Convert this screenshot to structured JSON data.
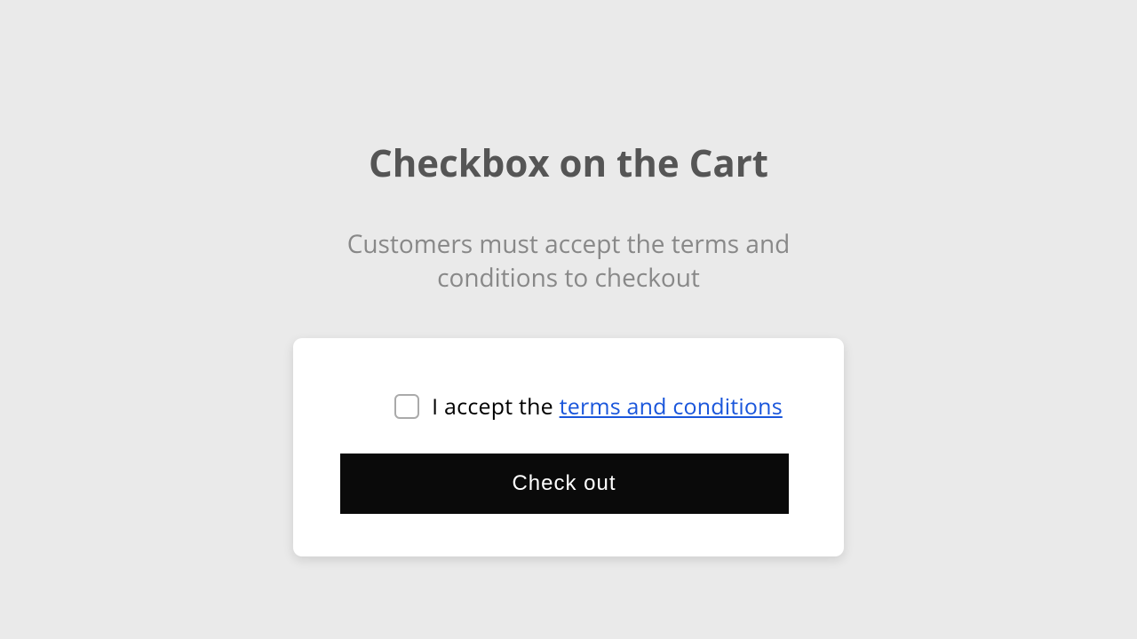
{
  "heading": "Checkbox on the Cart",
  "subheading": "Customers must accept the terms and conditions to checkout",
  "card": {
    "accept_prefix": "I accept the ",
    "terms_link_text": "terms and conditions",
    "checkout_button": "Check out"
  }
}
